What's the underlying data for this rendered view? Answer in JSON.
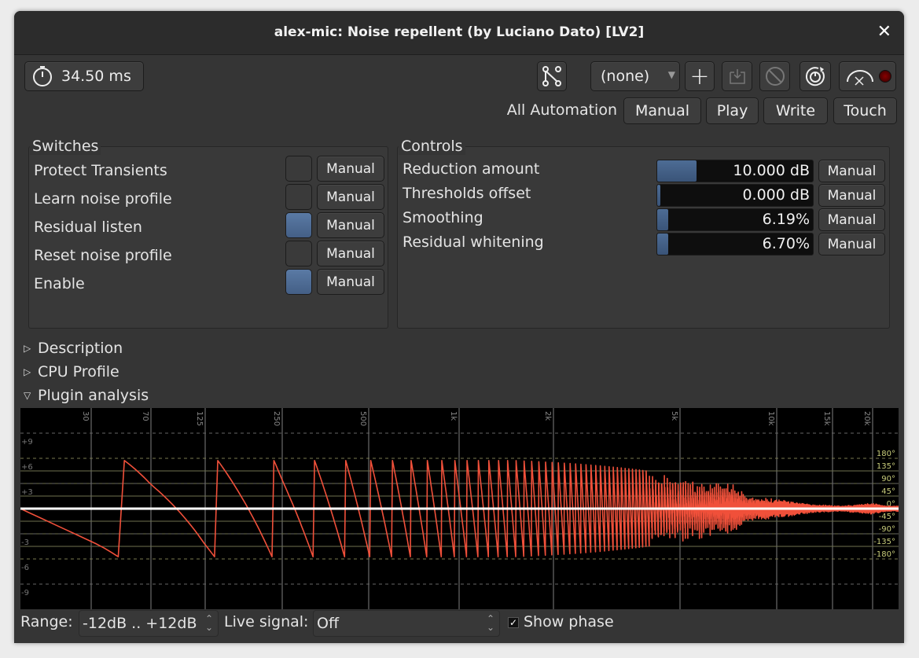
{
  "window": {
    "title": "alex-mic: Noise repellent (by Luciano Dato) [LV2]",
    "close_icon": "close-icon"
  },
  "toolbar": {
    "latency_label": "34.50 ms",
    "preset_value": "(none)",
    "all_automation_label": "All Automation",
    "automation_buttons": [
      "Manual",
      "Play",
      "Write",
      "Touch"
    ]
  },
  "switches": {
    "title": "Switches",
    "items": [
      {
        "label": "Protect Transients",
        "on": false,
        "mode": "Manual"
      },
      {
        "label": "Learn noise profile",
        "on": false,
        "mode": "Manual"
      },
      {
        "label": "Residual listen",
        "on": true,
        "mode": "Manual"
      },
      {
        "label": "Reset noise profile",
        "on": false,
        "mode": "Manual"
      },
      {
        "label": "Enable",
        "on": true,
        "mode": "Manual"
      }
    ]
  },
  "controls": {
    "title": "Controls",
    "items": [
      {
        "label": "Reduction amount",
        "value": "10.000 dB",
        "fill": 0.25,
        "mode": "Manual"
      },
      {
        "label": "Thresholds offset",
        "value": "0.000 dB",
        "fill": 0.01,
        "mode": "Manual"
      },
      {
        "label": "Smoothing",
        "value": "6.19%",
        "fill": 0.07,
        "mode": "Manual"
      },
      {
        "label": "Residual whitening",
        "value": "6.70%",
        "fill": 0.07,
        "mode": "Manual"
      }
    ]
  },
  "expanders": [
    {
      "label": "Description",
      "open": false
    },
    {
      "label": "CPU Profile",
      "open": false
    },
    {
      "label": "Plugin analysis",
      "open": true
    }
  ],
  "analysis": {
    "range_label": "Range:",
    "range_value": "-12dB .. +12dB",
    "live_label": "Live signal:",
    "live_value": "Off",
    "show_phase_label": "Show phase",
    "show_phase": true
  },
  "colors": {
    "accent": "#4d6c95",
    "phase": "#f0503a",
    "magnitude": "#ffffff",
    "phase_grid": "#6f7250"
  },
  "chart_data": {
    "type": "line",
    "x_ticks": [
      "30",
      "70",
      "125",
      "250",
      "500",
      "1k",
      "2k",
      "5k",
      "10k",
      "15k",
      "20k"
    ],
    "x_tick_values": [
      30,
      70,
      125,
      250,
      500,
      1000,
      2000,
      5000,
      10000,
      15000,
      20000
    ],
    "y_ticks": [
      "+9",
      "+6",
      "+3",
      "-3",
      "-6",
      "-9"
    ],
    "y_tick_values": [
      9,
      6,
      3,
      -3,
      -6,
      -9
    ],
    "phase_ticks": [
      "180°",
      "135°",
      "90°",
      "45°",
      "0°",
      "-45°",
      "-90°",
      "-135°",
      "-180°"
    ],
    "phase_tick_values": [
      180,
      135,
      90,
      45,
      0,
      -45,
      -90,
      -135,
      -180
    ],
    "ylim": [
      -12,
      12
    ],
    "series": [
      {
        "kind": "magnitude",
        "unit": "dB",
        "points": [
          [
            0,
            0
          ],
          [
            22000,
            0
          ]
        ]
      },
      {
        "kind": "phase",
        "unit": "deg",
        "wrap_period_hz": 92,
        "envelope": [
          [
            0,
            180
          ],
          [
            1500,
            180
          ],
          [
            2500,
            165
          ],
          [
            4000,
            140
          ],
          [
            5500,
            115
          ],
          [
            7500,
            90
          ],
          [
            8000,
            45
          ],
          [
            10000,
            35
          ],
          [
            13000,
            15
          ],
          [
            16000,
            10
          ],
          [
            20000,
            20
          ],
          [
            22000,
            10
          ]
        ]
      }
    ]
  }
}
